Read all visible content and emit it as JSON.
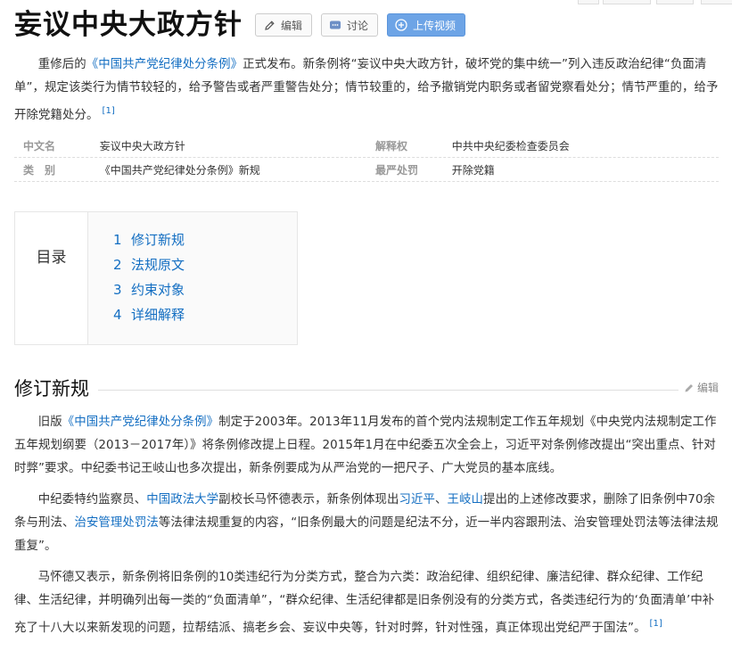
{
  "header": {
    "title": "妄议中央大政方针",
    "edit_label": "编辑",
    "discuss_label": "讨论",
    "upload_label": "上传视频"
  },
  "intro": {
    "p1": "重修后的",
    "link1": "《中国共产党纪律处分条例》",
    "p2": "正式发布。新条例将“妄议中央大政方针，破坏党的集中统一”列入违反政治纪律“负面清单”，规定该类行为情节较轻的，给予警告或者严重警告处分；情节较重的，给予撤销党内职务或者留党察看处分；情节严重的，给予开除党籍处分。",
    "ref": "[1]"
  },
  "infobox": {
    "rows": [
      {
        "k1": "中文名",
        "v1": "妄议中央大政方针",
        "k2": "解释权",
        "v2": "中共中央纪委检查委员会"
      },
      {
        "k1": "类　别",
        "v1": "《中国共产党纪律处分条例》新规",
        "k2": "最严处罚",
        "v2": "开除党籍"
      }
    ]
  },
  "toc": {
    "heading": "目录",
    "items": [
      {
        "num": "1",
        "label": "修订新规"
      },
      {
        "num": "2",
        "label": "法规原文"
      },
      {
        "num": "3",
        "label": "约束对象"
      },
      {
        "num": "4",
        "label": "详细解释"
      }
    ]
  },
  "section1": {
    "title": "修订新规",
    "edit_label": "编辑",
    "para1": {
      "a": "旧版",
      "link": "《中国共产党纪律处分条例》",
      "b": "制定于2003年。2013年11月发布的首个党内法规制定工作五年规划《中央党内法规制定工作五年规划纲要（2013－2017年）》将条例修改提上日程。2015年1月在中纪委五次全会上，习近平对条例修改提出“突出重点、针对时弊”要求。中纪委书记王岐山也多次提出，新条例要成为从严治党的一把尺子、广大党员的基本底线。"
    },
    "para2": {
      "a": "中纪委特约监察员、",
      "link1": "中国政法大学",
      "b": "副校长马怀德表示，新条例体现出",
      "link2": "习近平",
      "c": "、",
      "link3": "王岐山",
      "d": "提出的上述修改要求，删除了旧条例中70余条与刑法、",
      "link4": "治安管理处罚法",
      "e": "等法律法规重复的内容，“旧条例最大的问题是纪法不分，近一半内容跟刑法、治安管理处罚法等法律法规重复”。"
    },
    "para3": {
      "a": "马怀德又表示，新条例将旧条例的10类违纪行为分类方式，整合为六类：政治纪律、组织纪律、廉洁纪律、群众纪律、工作纪律、生活纪律，并明确列出每一类的“负面清单”，“群众纪律、生活纪律都是旧条例没有的分类方式，各类违纪行为的‘负面清单’中补充了十八大以来新发现的问题，拉帮结派、搞老乡会、妄议中央等，针对时弊，针对性强，真正体现出党纪严于国法”。",
      "ref": "[1]"
    }
  },
  "colors": {
    "link": "#136ec2",
    "upload_button": "#6da4e6",
    "text": "#333333"
  }
}
